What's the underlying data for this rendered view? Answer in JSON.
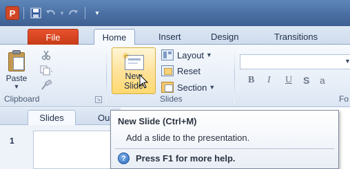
{
  "quick_access": {
    "icons": [
      "powerpoint-logo",
      "save-icon",
      "undo-icon",
      "redo-icon",
      "customize-icon"
    ],
    "logo_letter": "P"
  },
  "ribbon_tabs": {
    "file": "File",
    "home": "Home",
    "insert": "Insert",
    "design": "Design",
    "transitions": "Transitions",
    "active": "Home"
  },
  "clipboard_group": {
    "paste_label": "Paste",
    "group_label": "Clipboard",
    "small_icons": [
      "cut-icon",
      "copy-icon",
      "format-painter-icon"
    ]
  },
  "slides_group": {
    "new_slide_label_line1": "New",
    "new_slide_label_line2": "Slide",
    "layout_label": "Layout",
    "reset_label": "Reset",
    "section_label": "Section",
    "group_label": "Slides"
  },
  "font_group": {
    "group_label": "Fo",
    "buttons": [
      "B",
      "I",
      "U",
      "S",
      "a"
    ]
  },
  "pane": {
    "slides_tab": "Slides",
    "outline_tab": "Ou",
    "slide_number": "1"
  },
  "tooltip": {
    "title": "New Slide (Ctrl+M)",
    "description": "Add a slide to the presentation.",
    "help_text": "Press F1 for more help."
  },
  "colors": {
    "file_tab": "#d24726",
    "title_bar": "#4a6fa3",
    "new_slide_highlight": "#ffe39c",
    "help_icon": "#2e6cc0"
  }
}
